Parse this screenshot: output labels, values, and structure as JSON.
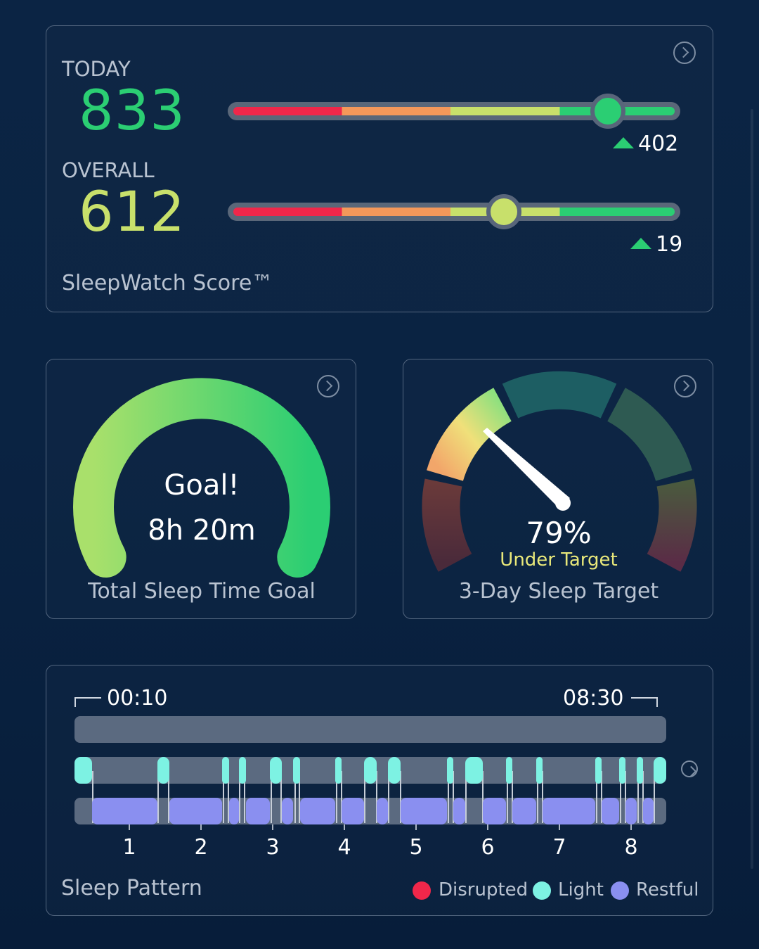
{
  "score_card": {
    "today_label": "TODAY",
    "today_value": "833",
    "today_delta": "402",
    "today_position": 0.84,
    "overall_label": "OVERALL",
    "overall_value": "612",
    "overall_delta": "19",
    "overall_position": 0.61,
    "title": "SleepWatch Score™",
    "colors": {
      "today": "#2bce73",
      "overall": "#c8e06b",
      "up_arrow": "#2bce73"
    }
  },
  "goal_card": {
    "headline": "Goal!",
    "value": "8h 20m",
    "title": "Total Sleep Time Goal"
  },
  "target_card": {
    "percent": "79%",
    "status": "Under Target",
    "title": "3-Day Sleep Target",
    "colors": {
      "status": "#e9e87a"
    }
  },
  "pattern_card": {
    "start_time": "00:10",
    "end_time": "08:30",
    "hours": [
      "1",
      "2",
      "3",
      "4",
      "5",
      "6",
      "7",
      "8"
    ],
    "title": "Sleep Pattern",
    "legend": [
      {
        "label": "Disrupted",
        "color": "#f0274a"
      },
      {
        "label": "Light",
        "color": "#7df2e3"
      },
      {
        "label": "Restful",
        "color": "#8a8ff0"
      }
    ]
  }
}
